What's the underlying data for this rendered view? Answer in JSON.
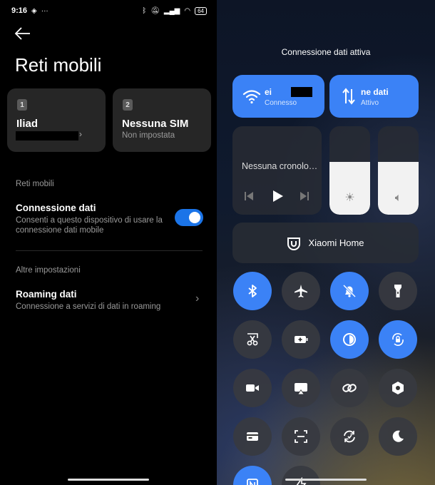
{
  "status": {
    "time": "9:16",
    "battery": "64"
  },
  "settings": {
    "title": "Reti mobili",
    "sims": [
      {
        "num": "1",
        "name": "Iliad",
        "sub": ""
      },
      {
        "num": "2",
        "name": "Nessuna SIM",
        "sub": "Non impostata"
      }
    ],
    "section_mobile": "Reti mobili",
    "data_title": "Connessione dati",
    "data_sub": "Consenti a questo dispositivo di usare la connessione dati mobile",
    "section_other": "Altre impostazioni",
    "roaming_title": "Roaming dati",
    "roaming_sub": "Connessione a servizi di dati in roaming"
  },
  "control_center": {
    "header": "Connessione dati attiva",
    "wifi_label": "ei",
    "wifi_sub": "Connesso",
    "data_label": "ne dati",
    "data_sub": "Attivo",
    "media_title": "Nessuna cronolo…",
    "xiaomi_home": "Xiaomi Home",
    "brightness_level": 0.6,
    "volume_level": 0.6,
    "accent": "#3b82f6"
  }
}
